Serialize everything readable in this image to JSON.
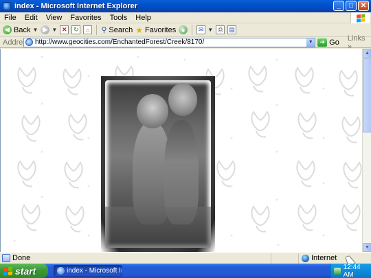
{
  "window": {
    "title": "index - Microsoft Internet Explorer",
    "controls": {
      "minimize": "_",
      "maximize": "□",
      "close": "✕"
    }
  },
  "menu": [
    "File",
    "Edit",
    "View",
    "Favorites",
    "Tools",
    "Help"
  ],
  "toolbar": {
    "back_label": "Back",
    "search_label": "Search",
    "favorites_label": "Favorites"
  },
  "address": {
    "label": "Address",
    "url": "http://www.geocities.com/EnchantedForest/Creek/8170/",
    "go_label": "Go",
    "links_label": "Links"
  },
  "status": {
    "text": "Done",
    "zone": "Internet"
  },
  "taskbar": {
    "start_label": "start",
    "task_label": "index - Microsoft Inte...",
    "clock": "12:44 AM"
  },
  "colors": {
    "titlebar": "#0052cc",
    "taskbar": "#245edb",
    "start": "#3a9a36",
    "chrome": "#ece9d8"
  },
  "icons": {
    "back": "back-arrow-icon",
    "forward": "forward-arrow-icon",
    "stop": "stop-icon",
    "refresh": "refresh-icon",
    "home": "home-icon",
    "search": "search-icon",
    "favorites": "star-icon",
    "media": "media-icon",
    "mail": "mail-icon",
    "print": "print-icon",
    "edit": "edit-icon"
  }
}
